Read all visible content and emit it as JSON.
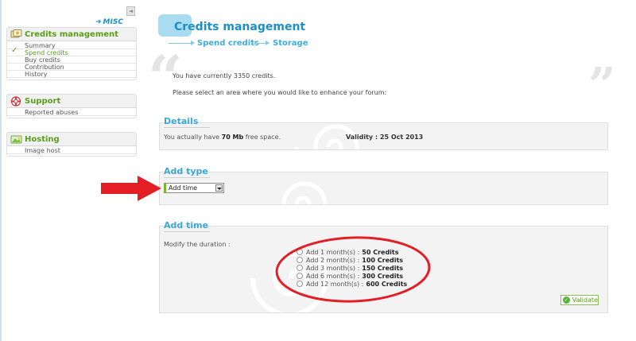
{
  "sidebar": {
    "misc_label": "MISC",
    "collapse_glyph": "◄",
    "panels": [
      {
        "icon": "credits-icon",
        "title": "Credits management",
        "items": [
          {
            "label": "Summary",
            "active": false
          },
          {
            "label": "Spend credits",
            "active": true
          },
          {
            "label": "Buy credits",
            "active": false
          },
          {
            "label": "Contribution",
            "active": false
          },
          {
            "label": "History",
            "active": false
          }
        ]
      },
      {
        "icon": "lifebuoy-icon",
        "title": "Support",
        "items": [
          {
            "label": "Reported abuses",
            "active": false
          }
        ]
      },
      {
        "icon": "hosting-icon",
        "title": "Hosting",
        "items": [
          {
            "label": "Image host",
            "active": false
          }
        ]
      }
    ]
  },
  "header": {
    "title": "Credits management",
    "breadcrumb": [
      "Spend credits",
      "Storage"
    ]
  },
  "intro": {
    "credits_line": "You have currently 3350 credits.",
    "select_line": "Please select an area where you would like to enhance your forum:"
  },
  "details": {
    "title": "Details",
    "space_prefix": "You actually have",
    "space_value": "70 Mb",
    "space_suffix": "free space.",
    "validity": "Validity : 25 Oct 2013"
  },
  "add_type": {
    "title": "Add type",
    "selected": "Add time"
  },
  "add_time": {
    "title": "Add time",
    "modify_label": "Modify the duration :",
    "options": [
      {
        "label": "Add 1 month(s) :",
        "credits": "50 Credits"
      },
      {
        "label": "Add 2 month(s) :",
        "credits": "100 Credits"
      },
      {
        "label": "Add 3 month(s) :",
        "credits": "150 Credits"
      },
      {
        "label": "Add 6 month(s) :",
        "credits": "300 Credits"
      },
      {
        "label": "Add 12 month(s) :",
        "credits": "600 Credits"
      }
    ],
    "validate_label": "Validate"
  },
  "colors": {
    "accent_blue": "#1d8fc6",
    "accent_green": "#5a9d1a",
    "annotation_red": "#e31e24"
  }
}
